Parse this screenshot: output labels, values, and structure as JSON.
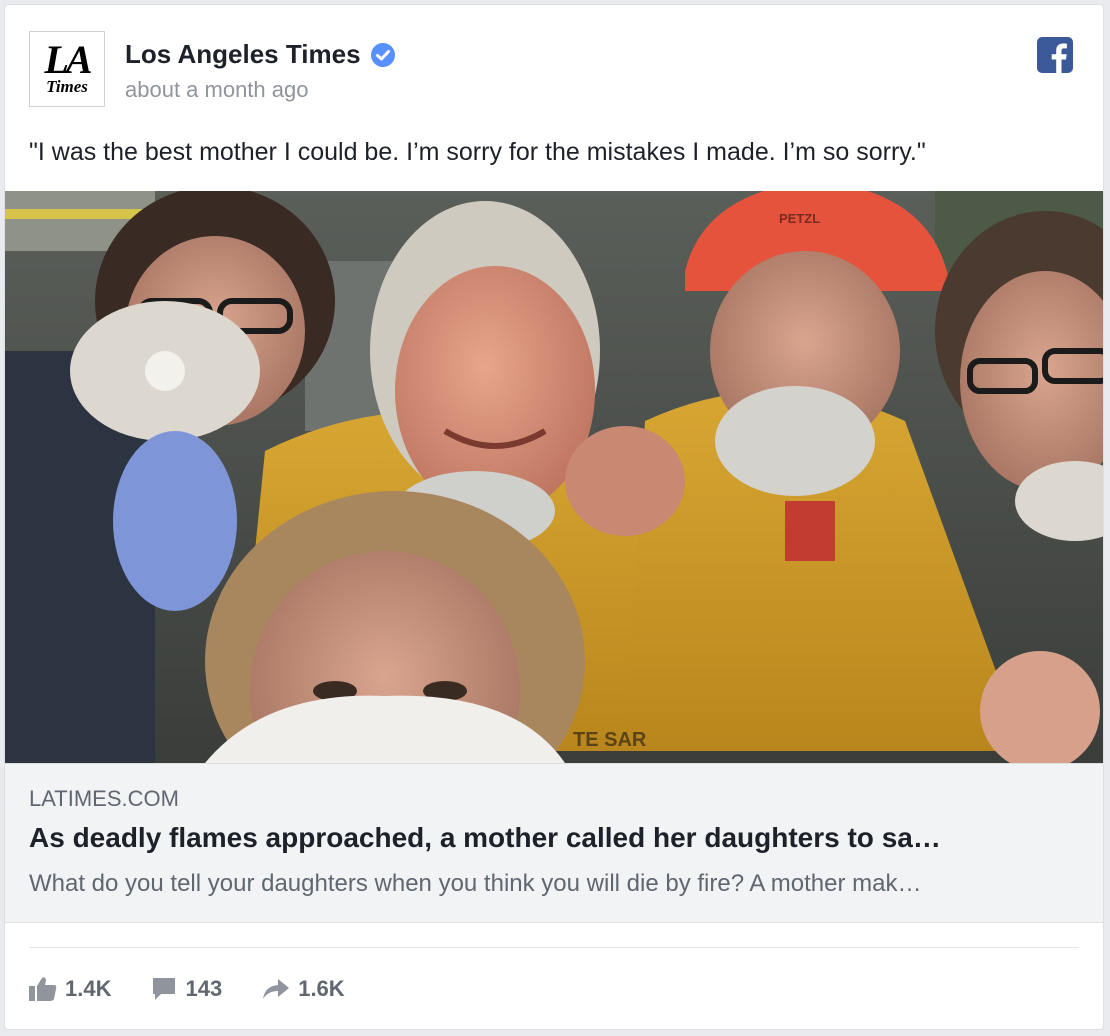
{
  "post": {
    "page_name": "Los Angeles Times",
    "logo": {
      "line1": "LA",
      "line2": "Times"
    },
    "timestamp": "about a month ago",
    "message": "\"I was the best mother I could be. I’m sorry for the mistakes I made. I’m so sorry.\"",
    "icons": {
      "verified": "verified-badge-icon",
      "platform": "facebook-icon"
    },
    "colors": {
      "verified": "#5890ff",
      "facebook": "#3b5998"
    }
  },
  "link": {
    "domain": "LATIMES.COM",
    "title": "As deadly flames approached, a mother called her daughters to sa…",
    "description": "What do you tell your daughters when you think you will die by fire? A mother mak…"
  },
  "photo": {
    "visible_text": [
      "PETZL",
      "TE SAR"
    ]
  },
  "stats": {
    "likes": "1.4K",
    "comments": "143",
    "shares": "1.6K"
  }
}
